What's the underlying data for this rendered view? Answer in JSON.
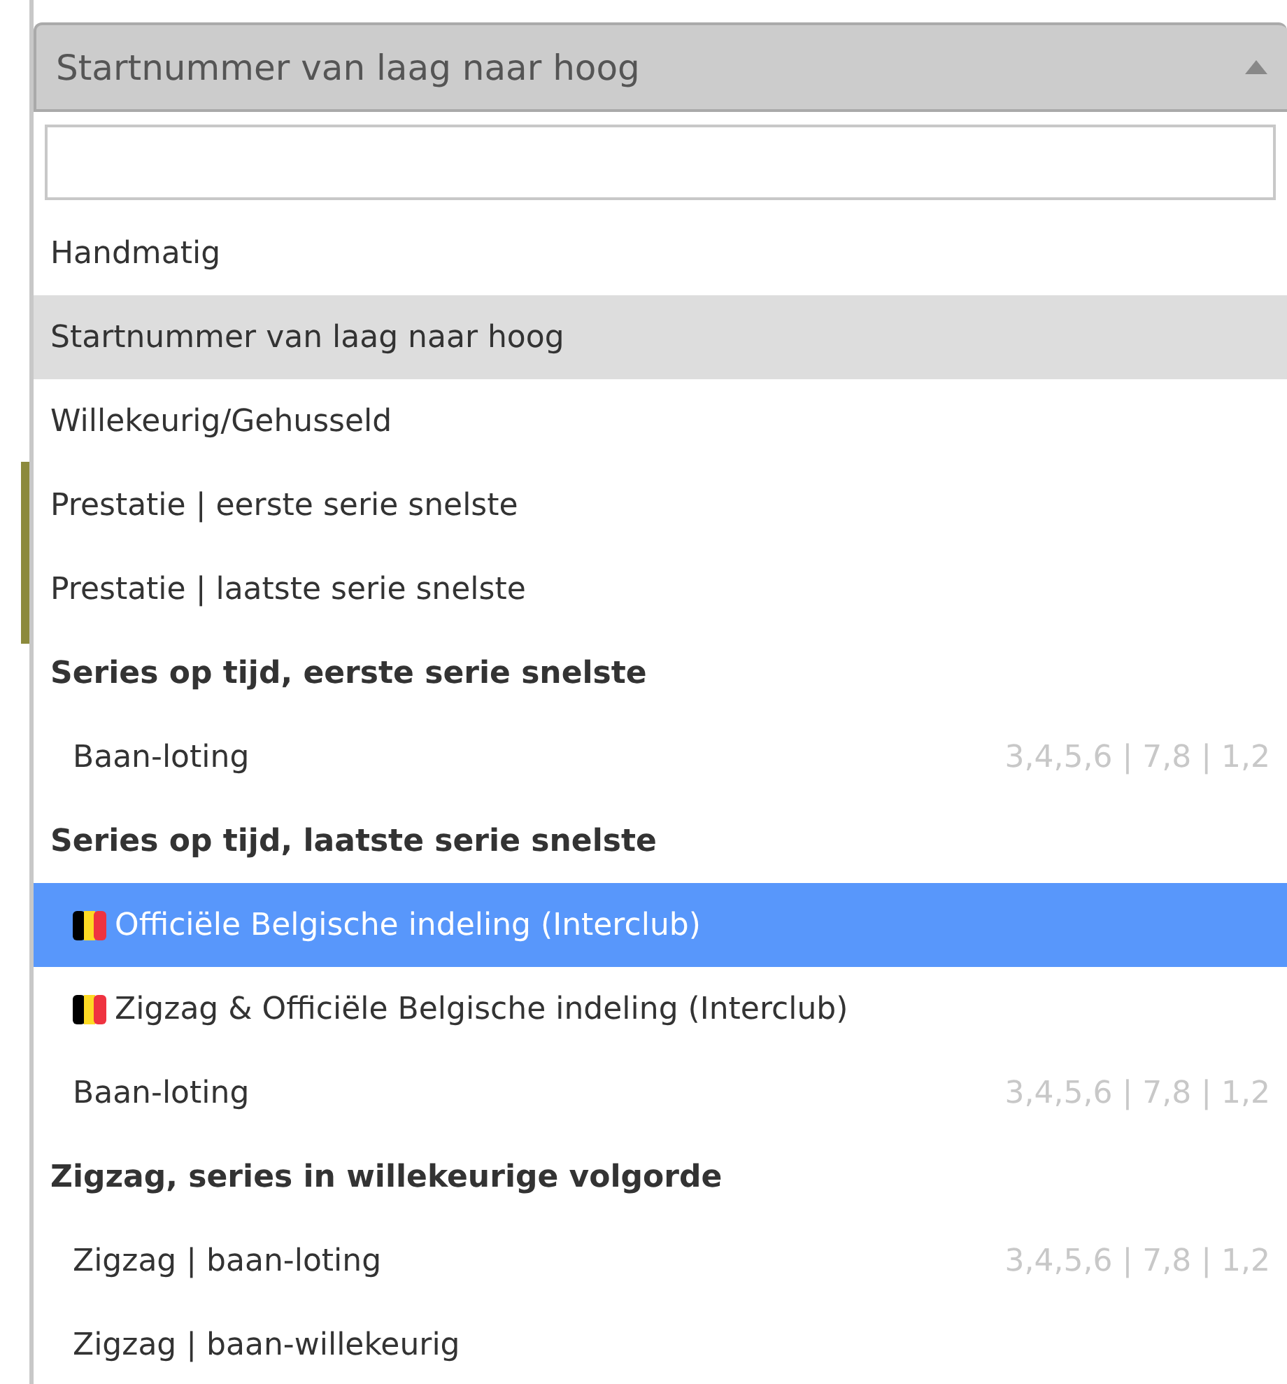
{
  "dropdown": {
    "value": "Startnummer van laag naar hoog",
    "expanded": true,
    "options": [
      {
        "kind": "option",
        "label": "Handmatig",
        "selected": false,
        "highlighted": false
      },
      {
        "kind": "option",
        "label": "Startnummer van laag naar hoog",
        "selected": true,
        "highlighted": false
      },
      {
        "kind": "option",
        "label": "Willekeurig/Gehusseld",
        "selected": false,
        "highlighted": false
      },
      {
        "kind": "option",
        "label": "Prestatie | eerste serie snelste",
        "selected": false,
        "highlighted": false
      },
      {
        "kind": "option",
        "label": "Prestatie | laatste serie snelste",
        "selected": false,
        "highlighted": false
      },
      {
        "kind": "group",
        "label": "Series op tijd, eerste serie snelste",
        "children": [
          {
            "label": "Baan-loting",
            "hint": "3,4,5,6 | 7,8 | 1,2",
            "flag": false,
            "selected": false,
            "highlighted": false
          }
        ]
      },
      {
        "kind": "group",
        "label": "Series op tijd, laatste serie snelste",
        "children": [
          {
            "label": "Officiële Belgische indeling (Interclub)",
            "flag": true,
            "selected": false,
            "highlighted": true
          },
          {
            "label": "Zigzag & Officiële Belgische indeling (Interclub)",
            "flag": true,
            "selected": false,
            "highlighted": false
          },
          {
            "label": "Baan-loting",
            "hint": "3,4,5,6 | 7,8 | 1,2",
            "flag": false,
            "selected": false,
            "highlighted": false
          }
        ]
      },
      {
        "kind": "group",
        "label": "Zigzag, series in willekeurige volgorde",
        "children": [
          {
            "label": "Zigzag | baan-loting",
            "hint": "3,4,5,6 | 7,8 | 1,2",
            "flag": false,
            "selected": false,
            "highlighted": false
          },
          {
            "label": "Zigzag | baan-willekeurig",
            "flag": false,
            "selected": false,
            "highlighted": false
          }
        ]
      }
    ]
  }
}
